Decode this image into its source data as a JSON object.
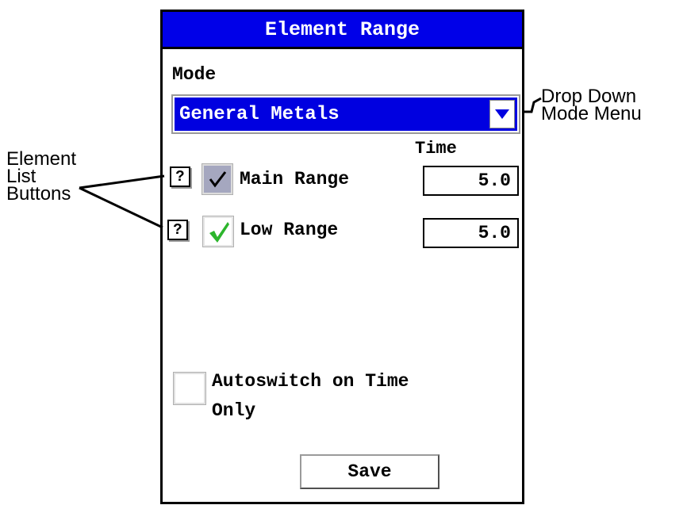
{
  "dialog": {
    "title": "Element Range",
    "mode_label": "Mode",
    "mode_value": "General Metals",
    "time_header": "Time",
    "ranges": [
      {
        "help_label": "?",
        "checked": true,
        "label": "Main Range",
        "time": "5.0",
        "check_color": "#000000"
      },
      {
        "help_label": "?",
        "checked": true,
        "label": "Low Range",
        "time": "5.0",
        "check_color": "#22aa22"
      }
    ],
    "autoswitch": {
      "checked": false,
      "label": "Autoswitch on Time Only"
    },
    "save_label": "Save"
  },
  "annotations": {
    "dropdown_note_line1": "Drop Down",
    "dropdown_note_line2": "Mode Menu",
    "element_note_line1": "Element",
    "element_note_line2": "List",
    "element_note_line3": "Buttons"
  },
  "colors": {
    "title_bar": "#0000e8",
    "dropdown_bg": "#0000e0",
    "checked_dark_bg": "#a5a7bf"
  },
  "icons": {
    "dropdown_arrow": "triangle-down-icon",
    "check_main": "checkmark-icon",
    "check_low": "green-checkmark-icon"
  }
}
